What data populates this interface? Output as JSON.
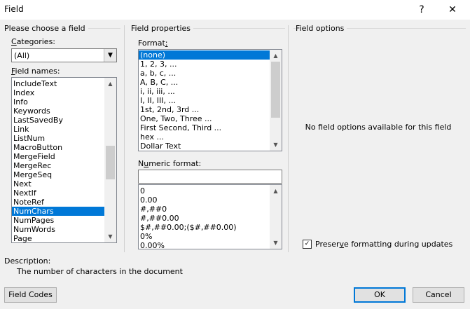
{
  "window": {
    "title": "Field",
    "help": "?",
    "close": "✕"
  },
  "choose": {
    "group_label": "Please choose a field",
    "categories_label_pre": "",
    "categories_label_u": "C",
    "categories_label_post": "ategories:",
    "categories_value": "(All)",
    "field_names_label_pre": "",
    "field_names_label_u": "F",
    "field_names_label_post": "ield names:",
    "field_names": [
      "IncludeText",
      "Index",
      "Info",
      "Keywords",
      "LastSavedBy",
      "Link",
      "ListNum",
      "MacroButton",
      "MergeField",
      "MergeRec",
      "MergeSeq",
      "Next",
      "NextIf",
      "NoteRef",
      "NumChars",
      "NumPages",
      "NumWords",
      "Page"
    ],
    "selected_field": "NumChars",
    "field_names_scroll_position": 0.45
  },
  "props": {
    "group_label": "Field properties",
    "format_label_pre": "Format",
    "format_label_u": ":",
    "format_label_post": "",
    "formats": [
      "(none)",
      "1, 2, 3, ...",
      "a, b, c, ...",
      "A, B, C, ...",
      "i, ii, iii, ...",
      "I, II, III, ...",
      "1st, 2nd, 3rd ...",
      "One, Two, Three ...",
      "First Second, Third ...",
      "hex ...",
      "Dollar Text"
    ],
    "selected_format": "(none)",
    "numeric_label_pre": "N",
    "numeric_label_u": "u",
    "numeric_label_post": "meric format:",
    "numeric_value": "",
    "numeric_formats": [
      "0",
      "0.00",
      "#,##0",
      "#,##0.00",
      "$#,##0.00;($#,##0.00)",
      "0%",
      "0.00%"
    ]
  },
  "options": {
    "group_label": "Field options",
    "empty_text": "No field options available for this field",
    "preserve_pre": "Preser",
    "preserve_u": "v",
    "preserve_post": "e formatting during updates",
    "preserve_checked": true,
    "check_glyph": "✓"
  },
  "description": {
    "label": "Description:",
    "text": "The number of characters in the document"
  },
  "buttons": {
    "field_codes": "Field Codes",
    "ok": "OK",
    "cancel": "Cancel"
  },
  "glyphs": {
    "up": "▲",
    "down": "▼",
    "combo": "▼"
  }
}
